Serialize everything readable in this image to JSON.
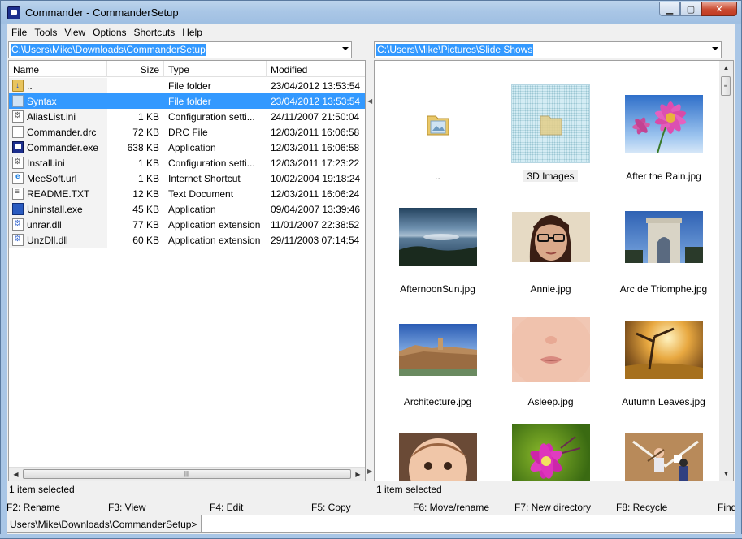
{
  "window": {
    "title": "Commander - CommanderSetup",
    "minimize": "▁",
    "maximize": "▢",
    "close": "✕"
  },
  "menu": [
    "File",
    "Tools",
    "View",
    "Options",
    "Shortcuts",
    "Help"
  ],
  "left": {
    "path": "C:\\Users\\Mike\\Downloads\\CommanderSetup",
    "columns": {
      "name": "Name",
      "size": "Size",
      "type": "Type",
      "modified": "Modified"
    },
    "files": [
      {
        "name": "..",
        "size": "",
        "type": "File folder",
        "modified": "23/04/2012 13:53:54",
        "icon": "folder-up-icon"
      },
      {
        "name": "Syntax",
        "size": "",
        "type": "File folder",
        "modified": "23/04/2012 13:53:54",
        "icon": "folder-icon",
        "selected": true
      },
      {
        "name": "AliasList.ini",
        "size": "1 KB",
        "type": "Configuration setti...",
        "modified": "24/11/2007 21:50:04",
        "icon": "ini-file-icon"
      },
      {
        "name": "Commander.drc",
        "size": "72 KB",
        "type": "DRC File",
        "modified": "12/03/2011 16:06:58",
        "icon": "blank-file-icon"
      },
      {
        "name": "Commander.exe",
        "size": "638 KB",
        "type": "Application",
        "modified": "12/03/2011 16:06:58",
        "icon": "exe-icon"
      },
      {
        "name": "Install.ini",
        "size": "1 KB",
        "type": "Configuration setti...",
        "modified": "12/03/2011 17:23:22",
        "icon": "ini-file-icon"
      },
      {
        "name": "MeeSoft.url",
        "size": "1 KB",
        "type": "Internet Shortcut",
        "modified": "10/02/2004 19:18:24",
        "icon": "url-icon"
      },
      {
        "name": "README.TXT",
        "size": "12 KB",
        "type": "Text Document",
        "modified": "12/03/2011 16:06:24",
        "icon": "text-file-icon"
      },
      {
        "name": "Uninstall.exe",
        "size": "45 KB",
        "type": "Application",
        "modified": "09/04/2007 13:39:46",
        "icon": "uninstall-icon"
      },
      {
        "name": "unrar.dll",
        "size": "77 KB",
        "type": "Application extension",
        "modified": "11/01/2007 22:38:52",
        "icon": "dll-icon"
      },
      {
        "name": "UnzDll.dll",
        "size": "60 KB",
        "type": "Application extension",
        "modified": "29/11/2003 07:14:54",
        "icon": "dll-icon"
      }
    ],
    "status": "1 item selected",
    "scroll_grip": "|||"
  },
  "right": {
    "path": "C:\\Users\\Mike\\Pictures\\Slide Shows",
    "items": [
      {
        "label": "..",
        "kind": "folder-up"
      },
      {
        "label": "3D Images",
        "kind": "folder",
        "selected": true
      },
      {
        "label": "After the Rain.jpg",
        "kind": "flower-sky"
      },
      {
        "label": "AfternoonSun.jpg",
        "kind": "sea"
      },
      {
        "label": "Annie.jpg",
        "kind": "portrait"
      },
      {
        "label": "Arc de Triomphe.jpg",
        "kind": "arch"
      },
      {
        "label": "Architecture.jpg",
        "kind": "building"
      },
      {
        "label": "Asleep.jpg",
        "kind": "baby-face"
      },
      {
        "label": "Autumn Leaves.jpg",
        "kind": "autumn"
      },
      {
        "label": "",
        "kind": "child"
      },
      {
        "label": "",
        "kind": "pink-flower"
      },
      {
        "label": "",
        "kind": "baseball"
      }
    ],
    "status": "1 item selected",
    "scroll_grip": "≡"
  },
  "function_keys": [
    "F2: Rename",
    "F3: View",
    "F4: Edit",
    "F5: Copy",
    "F6: Move/rename",
    "F7: New directory",
    "F8: Recycle",
    "Find"
  ],
  "command": {
    "prompt": "Users\\Mike\\Downloads\\CommanderSetup>",
    "value": ""
  },
  "colors": {
    "selection": "#3399ff",
    "titlebar": "#a9c6e6",
    "close": "#c94a30"
  }
}
